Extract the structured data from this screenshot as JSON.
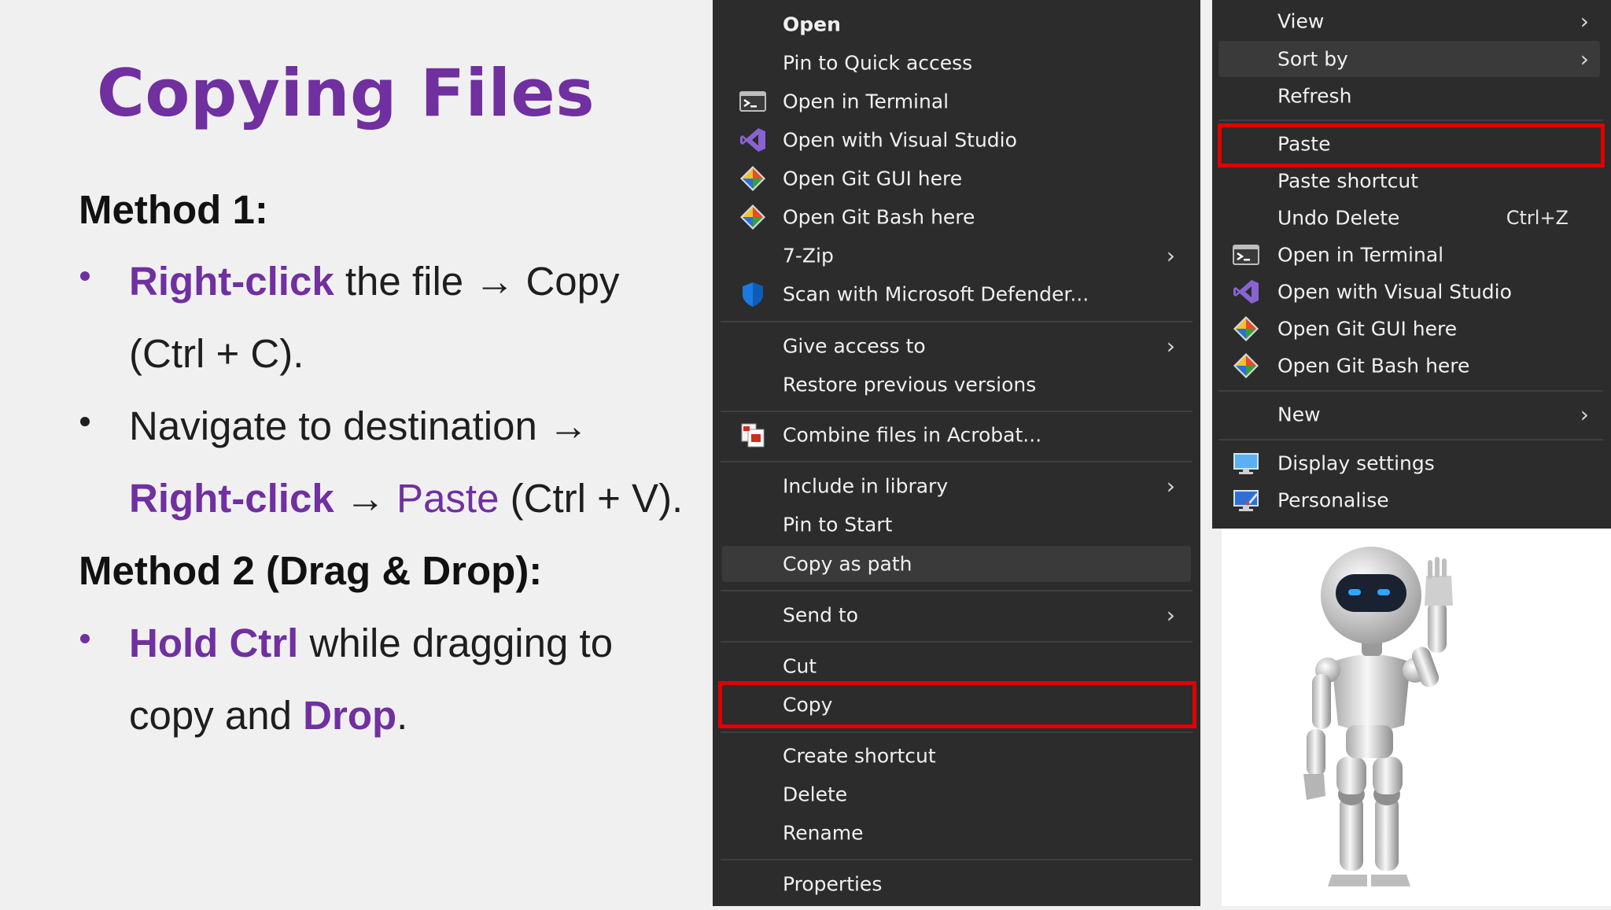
{
  "slide": {
    "title": "Copying Files",
    "method1_heading": "Method 1:",
    "b1_hl": "Right-click",
    "b1_t1": " the file → Copy",
    "b1_t2": "(Ctrl + C).",
    "b2_t1": "Navigate to destination →",
    "b2_hl1": "Right-click",
    "b2_t2": " → ",
    "b2_hl2": "Paste",
    "b2_t3": " (Ctrl + V).",
    "method2_heading": "Method 2 (Drag & Drop):",
    "b3_hl1": "Hold Ctrl",
    "b3_t1": " while dragging to",
    "b3_t2": "copy and ",
    "b3_hl2": "Drop",
    "b3_t3": "."
  },
  "colors": {
    "accent": "#7030a0",
    "menu_bg": "#2c2c2c",
    "highlight_box": "#e00000"
  },
  "file_menu": {
    "open": "Open",
    "pin_quick": "Pin to Quick access",
    "open_terminal": "Open in Terminal",
    "open_vs": "Open with Visual Studio",
    "git_gui": "Open Git GUI here",
    "git_bash": "Open Git Bash here",
    "zip": "7-Zip",
    "defender": "Scan with Microsoft Defender...",
    "give_access": "Give access to",
    "restore": "Restore previous versions",
    "acrobat": "Combine files in Acrobat...",
    "library": "Include in library",
    "pin_start": "Pin to Start",
    "copy_path": "Copy as path",
    "send_to": "Send to",
    "cut": "Cut",
    "copy": "Copy",
    "create_shortcut": "Create shortcut",
    "delete": "Delete",
    "rename": "Rename",
    "properties": "Properties"
  },
  "desktop_menu": {
    "view": "View",
    "sort_by": "Sort by",
    "refresh": "Refresh",
    "paste": "Paste",
    "paste_shortcut": "Paste shortcut",
    "undo_delete": "Undo Delete",
    "undo_shortcut": "Ctrl+Z",
    "open_terminal": "Open in Terminal",
    "open_vs": "Open with Visual Studio",
    "git_gui": "Open Git GUI here",
    "git_bash": "Open Git Bash here",
    "new": "New",
    "display": "Display settings",
    "personalise": "Personalise"
  },
  "icons": {
    "terminal": "terminal-icon",
    "visual_studio": "visual-studio-icon",
    "git": "git-icon",
    "defender": "shield-icon",
    "acrobat": "acrobat-icon",
    "display": "monitor-icon",
    "personalise": "personalise-icon",
    "submenu": "chevron-right-icon"
  }
}
